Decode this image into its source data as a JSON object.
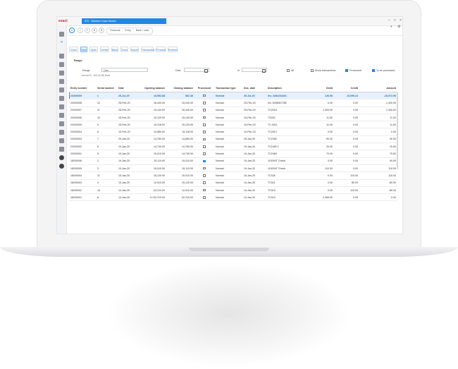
{
  "app": {
    "logo": "exact",
    "window_tab": "570 · Wackere Kaan Globex",
    "window_controls": [
      "–",
      "□",
      "×"
    ],
    "top_right_icons": [
      "+",
      "⚙"
    ]
  },
  "sidebar": {
    "items": [
      "search-icon",
      "collapse-icon",
      "dashboard-icon",
      "document-icon",
      "inbox-icon",
      "book-icon",
      "export-icon",
      "stamp-icon",
      "file-icon",
      "tools-icon",
      "bank-icon",
      "chart-icon",
      "settings-icon",
      "people-icon",
      "add-icon",
      "help-icon"
    ]
  },
  "breadcrumb": {
    "nav_buttons": [
      "⊖",
      "⟨",
      "F",
      "B",
      "B"
    ],
    "items": [
      "Financial",
      "Entry",
      "Bank / cash"
    ]
  },
  "toolbar": {
    "buttons": [
      "Close",
      "New",
      "Open",
      "Delete",
      "Bank",
      "Zoom",
      "Import",
      "Transaction",
      "Process",
      "Refresh"
    ],
    "active_index": 1
  },
  "range": {
    "title": "Range",
    "journal_label": "Range",
    "journal_value": "Date",
    "journal_sub": "Journal     20 · ING (EUR) Bank",
    "date_label": "Date",
    "to_label": "to",
    "all_label": "All",
    "show_transactions_label": "Show transactions",
    "processed_label": "Processed",
    "to_be_processed_label": "To be processed"
  },
  "table": {
    "columns": [
      "Entry number",
      "Serial number",
      "Date",
      "Opening balance",
      "Closing balance",
      "Processed",
      "Transaction type",
      "Doc. date",
      "Description",
      "Debit",
      "Credit",
      "Amount"
    ],
    "rows": [
      [
        "20200009",
        "1",
        "29-Jul-20",
        "10,593.88",
        "862.38",
        false,
        "Normal",
        "29-Jul-20",
        "Inv. 3282234401",
        "126.56",
        "10,099.24",
        "-10,972.90"
      ],
      [
        "20200008",
        "12",
        "25-Feb-20",
        "16,440.00",
        "15,040.00",
        false,
        "Normal",
        "25-Feb-20",
        "Inv. 0006067788",
        "0.00",
        "0.00",
        "-1,400.00"
      ],
      [
        "20200007",
        "11",
        "25-Feb-20",
        "15,140.00",
        "16,440.00",
        false,
        "Normal",
        "25-Feb-20",
        "TC2016",
        "1,300.00",
        "0.00",
        "1,300.00"
      ],
      [
        "20200006",
        "10",
        "15-Feb-20",
        "15,129.00",
        "15,140.00",
        false,
        "Normal",
        "15-Feb-20",
        "TS024",
        "11.00",
        "0.00",
        "11.00"
      ],
      [
        "20200005",
        "9",
        "15-Feb-20",
        "15,118.00",
        "15,129.00",
        false,
        "Normal",
        "15-Feb-20",
        "TC.3011",
        "11.00",
        "0.00",
        "11.00"
      ],
      [
        "20200004",
        "8",
        "10-Feb-20",
        "14,850.00",
        "15,118.00",
        false,
        "Normal",
        "10-Feb-20",
        "TC2912",
        "0.00",
        "0.00",
        "0.00"
      ],
      [
        "20200003",
        "7",
        "29-Jan-20",
        "14,760.00",
        "14,850.00",
        false,
        "Normal",
        "29-Jan-20",
        "TC2350",
        "90.00",
        "0.00",
        "90.00"
      ],
      [
        "20200002",
        "6",
        "19-Jan-20",
        "14,740.00",
        "14,760.00",
        false,
        "Normal",
        "19-Jan-20",
        "TC2450 2",
        "20.00",
        "0.00",
        "20.00"
      ],
      [
        "20200001",
        "5",
        "19-Jan-20",
        "15,010.00",
        "14,740.00",
        false,
        "Normal",
        "19-Jan-20",
        "TC2460",
        "70.00",
        "0.00",
        "70.00"
      ],
      [
        "18200006",
        "2",
        "19-Jan-20",
        "15,110.00",
        "15,010.00",
        true,
        "Normal",
        "19-Jan-20",
        "115294T Check",
        "0.00",
        "0.00",
        "90.00"
      ],
      [
        "18200005",
        "3",
        "19-Jan-20",
        "15,010.00",
        "15,110.00",
        false,
        "Normal",
        "19-Jan-20",
        "115294T Check",
        "110.00",
        "0.00",
        "110.00"
      ],
      [
        "18200004",
        "11",
        "15-Jan-20",
        "15,120.00",
        "15,010.00",
        false,
        "Normal",
        "15-Jan-20",
        "TC025",
        "0.00",
        "110.00",
        "110.00"
      ],
      [
        "18200003",
        "4",
        "13-Jan-20",
        "12,910.00",
        "15,120.00",
        false,
        "Normal",
        "13-Jan-20",
        "TC021",
        "0.00",
        "80.00",
        "-80.00"
      ],
      [
        "18200002",
        "10",
        "13-Jan-20",
        "-32,210.00",
        "12,910.00",
        false,
        "Normal",
        "13-Jan-20",
        "TC015",
        "0.00",
        "110.00",
        "-80.00"
      ],
      [
        "18200001",
        "8",
        "13-Jan-20",
        "0-+02,210.00",
        "-32,210.00",
        false,
        "Normal",
        "13-Jan-20",
        "TC013",
        "2,365.00",
        "0.00",
        "0.00"
      ]
    ],
    "selected_index": 0
  },
  "colors": {
    "accent": "#1e88e5",
    "brand": "#e2231a"
  }
}
